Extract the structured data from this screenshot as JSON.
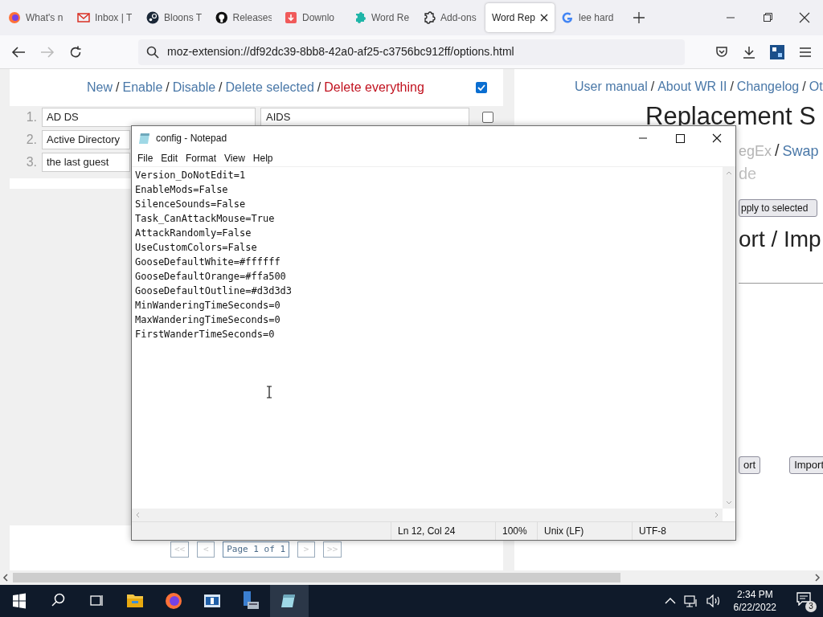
{
  "browser": {
    "tabs": [
      {
        "label": "What's n",
        "selected": false
      },
      {
        "label": "Inbox | T",
        "selected": false
      },
      {
        "label": "Bloons T",
        "selected": false
      },
      {
        "label": "Releases",
        "selected": false
      },
      {
        "label": "Downlo",
        "selected": false
      },
      {
        "label": "Word Re",
        "selected": false
      },
      {
        "label": "Add-ons",
        "selected": false
      },
      {
        "label": "Word Rep",
        "selected": true
      },
      {
        "label": "lee hard",
        "selected": false
      }
    ],
    "url": "moz-extension://df92dc39-8bb8-42a0-af25-c3756bc912ff/options.html"
  },
  "rules_panel": {
    "actions": [
      {
        "label": "New",
        "kind": "link"
      },
      {
        "label": "/",
        "kind": "separator"
      },
      {
        "label": "Enable",
        "kind": "link"
      },
      {
        "label": "/",
        "kind": "separator"
      },
      {
        "label": "Disable",
        "kind": "link"
      },
      {
        "label": "/",
        "kind": "separator"
      },
      {
        "label": "Delete selected",
        "kind": "link"
      },
      {
        "label": "/",
        "kind": "separator"
      },
      {
        "label": "Delete everything",
        "kind": "danger"
      }
    ],
    "select_all_checked": true,
    "rows": [
      {
        "number": "1.",
        "find": "AD DS",
        "replace": "AIDS",
        "checked": false
      },
      {
        "number": "2.",
        "find": "Active Directory"
      },
      {
        "number": "3.",
        "find": "the last guest"
      }
    ],
    "pagination": [
      {
        "label": "<<",
        "disabled": true
      },
      {
        "label": "<",
        "disabled": true
      },
      {
        "label": "Page 1 of 1",
        "disabled": false
      },
      {
        "label": ">",
        "disabled": true
      },
      {
        "label": ">>",
        "disabled": true
      }
    ]
  },
  "settings_panel": {
    "nav": [
      {
        "label": "User manual",
        "kind": "link"
      },
      {
        "label": "/",
        "kind": "separator"
      },
      {
        "label": "About WR II",
        "kind": "link"
      },
      {
        "label": "/",
        "kind": "separator"
      },
      {
        "label": "Changelog",
        "kind": "link"
      },
      {
        "label": "/",
        "kind": "separator"
      },
      {
        "label": "Ot",
        "kind": "link"
      }
    ],
    "heading": "Replacement S",
    "options": [
      {
        "label": "egEx",
        "kind": "disabled"
      },
      {
        "label": "/",
        "kind": "separator"
      },
      {
        "label": "Swap",
        "kind": "link"
      }
    ],
    "option_note": "de",
    "apply_button": "pply to selected",
    "export_heading": "ort / Imp",
    "buttons": [
      "ort",
      "Import"
    ]
  },
  "notepad": {
    "title": "config - Notepad",
    "menu": [
      "File",
      "Edit",
      "Format",
      "View",
      "Help"
    ],
    "lines": [
      "Version_DoNotEdit=1",
      "EnableMods=False",
      "SilenceSounds=False",
      "Task_CanAttackMouse=True",
      "AttackRandomly=False",
      "UseCustomColors=False",
      "GooseDefaultWhite=#ffffff",
      "GooseDefaultOrange=#ffa500",
      "GooseDefaultOutline=#d3d3d3",
      "MinWanderingTimeSeconds=0",
      "MaxWanderingTimeSeconds=0",
      "FirstWanderTimeSeconds=0"
    ],
    "status": [
      "Ln 12, Col 24",
      "100%",
      "Unix (LF)",
      "UTF-8"
    ]
  },
  "taskbar": {
    "time": "2:34 PM",
    "date": "6/22/2022",
    "notifications": "3"
  }
}
